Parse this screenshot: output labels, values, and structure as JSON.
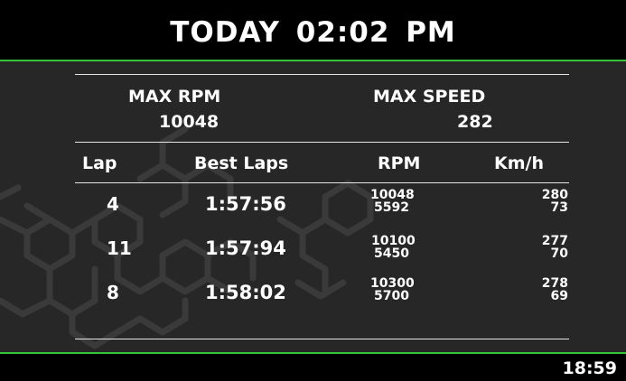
{
  "header": {
    "day": "TODAY",
    "time": "02:02 PM"
  },
  "summary": {
    "max_rpm_label": "MAX RPM",
    "max_rpm_value": "10048",
    "max_speed_label": "MAX SPEED",
    "max_speed_value": "282"
  },
  "table": {
    "headers": [
      "Lap",
      "Best Laps",
      "RPM",
      "Km/h"
    ],
    "rows": [
      {
        "lap": "4",
        "time": "1:57:56",
        "rpm_top": "10048",
        "rpm_bottom": "5592",
        "kmh_top": "280",
        "kmh_bottom": "73"
      },
      {
        "lap": "11",
        "time": "1:57:94",
        "rpm_top": "10100",
        "rpm_bottom": "5450",
        "kmh_top": "277",
        "kmh_bottom": "70"
      },
      {
        "lap": "8",
        "time": "1:58:02",
        "rpm_top": "10300",
        "rpm_bottom": "5700",
        "kmh_top": "278",
        "kmh_bottom": "69"
      }
    ]
  },
  "footer": {
    "clock": "18:59"
  },
  "colors": {
    "accent": "#36c23b",
    "panel": "#272727",
    "bar": "#000000",
    "text": "#ffffff"
  },
  "icons": {
    "background": "hexagon-pattern"
  }
}
